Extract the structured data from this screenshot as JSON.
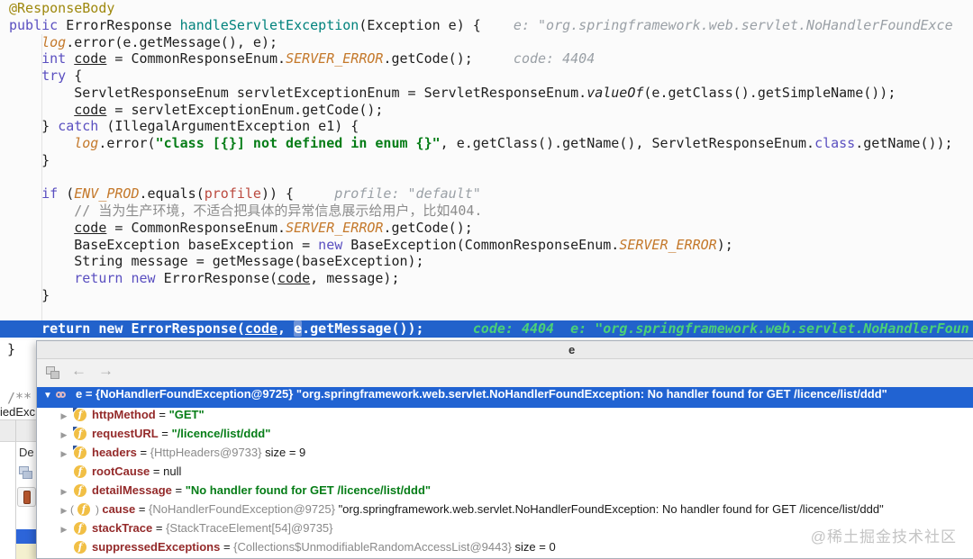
{
  "colors": {
    "accent_blue": "#2163d2",
    "highlight_line": "#2262cb",
    "string_green": "#067d17",
    "constant_orange": "#c4782a",
    "keyword_violet": "#5a4fc0",
    "field_name_red": "#942a2a"
  },
  "icons": {
    "expanded_glyph": "▼",
    "collapsed_glyph": "▶",
    "back_glyph": "←",
    "forward_glyph": "→",
    "field_glyph": "f"
  },
  "editor": {
    "lines": [
      {
        "segs": [
          [
            "@ResponseBody",
            "ann"
          ]
        ]
      },
      {
        "segs": [
          [
            "public ",
            "kw"
          ],
          [
            "ErrorResponse ",
            "pln"
          ],
          [
            "handleServletException",
            "decl"
          ],
          [
            "(Exception e) {",
            "pln"
          ],
          [
            "    e: \"org.springframework.web.servlet.NoHandlerFoundExce",
            "hint"
          ]
        ]
      },
      {
        "segs": [
          [
            "    ",
            "pln"
          ],
          [
            "log",
            "const"
          ],
          [
            ".error(e.getMessage(), e);",
            "pln"
          ]
        ]
      },
      {
        "segs": [
          [
            "    ",
            "pln"
          ],
          [
            "int ",
            "kw"
          ],
          [
            "code",
            "var"
          ],
          [
            " = CommonResponseEnum.",
            "pln"
          ],
          [
            "SERVER_ERROR",
            "const"
          ],
          [
            ".getCode();",
            "pln"
          ],
          [
            "     code: 4404",
            "hint"
          ]
        ]
      },
      {
        "segs": [
          [
            "    ",
            "pln"
          ],
          [
            "try ",
            "kw"
          ],
          [
            "{",
            "pln"
          ]
        ]
      },
      {
        "segs": [
          [
            "        ServletResponseEnum servletExceptionEnum = ServletResponseEnum.",
            "pln"
          ],
          [
            "valueOf",
            "stm"
          ],
          [
            "(e.getClass().getSimpleName());",
            "pln"
          ]
        ]
      },
      {
        "segs": [
          [
            "        ",
            "pln"
          ],
          [
            "code",
            "var"
          ],
          [
            " = servletExceptionEnum.getCode();",
            "pln"
          ]
        ]
      },
      {
        "segs": [
          [
            "    } ",
            "pln"
          ],
          [
            "catch ",
            "kw"
          ],
          [
            "(IllegalArgumentException e1) {",
            "pln"
          ]
        ]
      },
      {
        "segs": [
          [
            "        ",
            "pln"
          ],
          [
            "log",
            "const"
          ],
          [
            ".error(",
            "pln"
          ],
          [
            "\"class [{}] not defined in enum {}\"",
            "str"
          ],
          [
            ", e.getClass().getName(), ServletResponseEnum.",
            "pln"
          ],
          [
            "class",
            "kw"
          ],
          [
            ".getName());",
            "pln"
          ]
        ]
      },
      {
        "segs": [
          [
            "    }",
            "pln"
          ]
        ]
      },
      {
        "segs": [
          [
            "",
            "pln"
          ]
        ]
      },
      {
        "segs": [
          [
            "    ",
            "pln"
          ],
          [
            "if ",
            "kw"
          ],
          [
            "(",
            "pln"
          ],
          [
            "ENV_PROD",
            "const"
          ],
          [
            ".equals(",
            "pln"
          ],
          [
            "profile",
            "red"
          ],
          [
            ")) {",
            "pln"
          ],
          [
            "     profile: \"default\"",
            "hint"
          ]
        ]
      },
      {
        "segs": [
          [
            "        // 当为生产环境，不适合把具体的异常信息展示给用户，比如404.",
            "cmt"
          ]
        ]
      },
      {
        "segs": [
          [
            "        ",
            "pln"
          ],
          [
            "code",
            "var"
          ],
          [
            " = CommonResponseEnum.",
            "pln"
          ],
          [
            "SERVER_ERROR",
            "const"
          ],
          [
            ".getCode();",
            "pln"
          ]
        ]
      },
      {
        "segs": [
          [
            "        BaseException baseException = ",
            "pln"
          ],
          [
            "new ",
            "kw"
          ],
          [
            "BaseException(CommonResponseEnum.",
            "pln"
          ],
          [
            "SERVER_ERROR",
            "const"
          ],
          [
            ");",
            "pln"
          ]
        ]
      },
      {
        "segs": [
          [
            "        String message = getMessage(baseException);",
            "pln"
          ]
        ]
      },
      {
        "segs": [
          [
            "        ",
            "pln"
          ],
          [
            "return new ",
            "kw"
          ],
          [
            "ErrorResponse(",
            "pln"
          ],
          [
            "code",
            "var"
          ],
          [
            ", message);",
            "pln"
          ]
        ]
      },
      {
        "segs": [
          [
            "    }",
            "pln"
          ]
        ]
      },
      {
        "segs": [
          [
            "",
            "pln"
          ]
        ]
      },
      {
        "hl": true,
        "segs": [
          [
            "    return new ErrorResponse(",
            "hl"
          ],
          [
            "code",
            "hlvar"
          ],
          [
            ", ",
            "hl"
          ],
          [
            "e",
            "hlbox"
          ],
          [
            ".getMessage());",
            "hl"
          ],
          [
            "      ",
            "hl"
          ],
          [
            "code: 4404",
            "hlhint"
          ],
          [
            "  ",
            "hl"
          ],
          [
            "e: \"org.springframework.web.servlet.NoHandlerFoun",
            "hlhint"
          ]
        ]
      }
    ]
  },
  "left_panel": {
    "closing_brace": "}",
    "comment_start": "/**",
    "partial_text": "iedExc",
    "tab_label_partial": "De"
  },
  "popup": {
    "title": "e",
    "selected_row": {
      "text": "e = {NoHandlerFoundException@9725} \"org.springframework.web.servlet.NoHandlerFoundException: No handler found for GET /licence/list/ddd\""
    },
    "rows": [
      {
        "expander": true,
        "corner": true,
        "paren": false,
        "name": "httpMethod",
        "segs": [
          [
            "\"GET\"",
            "rstr"
          ]
        ]
      },
      {
        "expander": true,
        "corner": true,
        "paren": false,
        "name": "requestURL",
        "segs": [
          [
            "\"/licence/list/ddd\"",
            "rstr"
          ]
        ]
      },
      {
        "expander": true,
        "corner": true,
        "paren": false,
        "name": "headers",
        "segs": [
          [
            "{HttpHeaders@9733}",
            "rref"
          ],
          [
            "  size = 9",
            "rplain"
          ]
        ]
      },
      {
        "expander": false,
        "corner": false,
        "paren": false,
        "name": "rootCause",
        "segs": [
          [
            "null",
            "rplain"
          ]
        ]
      },
      {
        "expander": true,
        "corner": false,
        "paren": false,
        "name": "detailMessage",
        "segs": [
          [
            "\"No handler found for GET /licence/list/ddd\"",
            "rstr"
          ]
        ]
      },
      {
        "expander": true,
        "corner": false,
        "paren": true,
        "name": "cause",
        "segs": [
          [
            "{NoHandlerFoundException@9725}",
            "rref"
          ],
          [
            " \"org.springframework.web.servlet.NoHandlerFoundException: No handler found for GET /licence/list/ddd\"",
            "rplain"
          ]
        ]
      },
      {
        "expander": true,
        "corner": false,
        "paren": false,
        "name": "stackTrace",
        "segs": [
          [
            "{StackTraceElement[54]@9735}",
            "rref"
          ]
        ]
      },
      {
        "expander": false,
        "corner": false,
        "paren": false,
        "name": "suppressedExceptions",
        "segs": [
          [
            "{Collections$UnmodifiableRandomAccessList@9443}",
            "rref"
          ],
          [
            "  size = 0",
            "rplain"
          ]
        ]
      }
    ]
  },
  "watermark": {
    "text": "@稀土掘金技术社区"
  }
}
